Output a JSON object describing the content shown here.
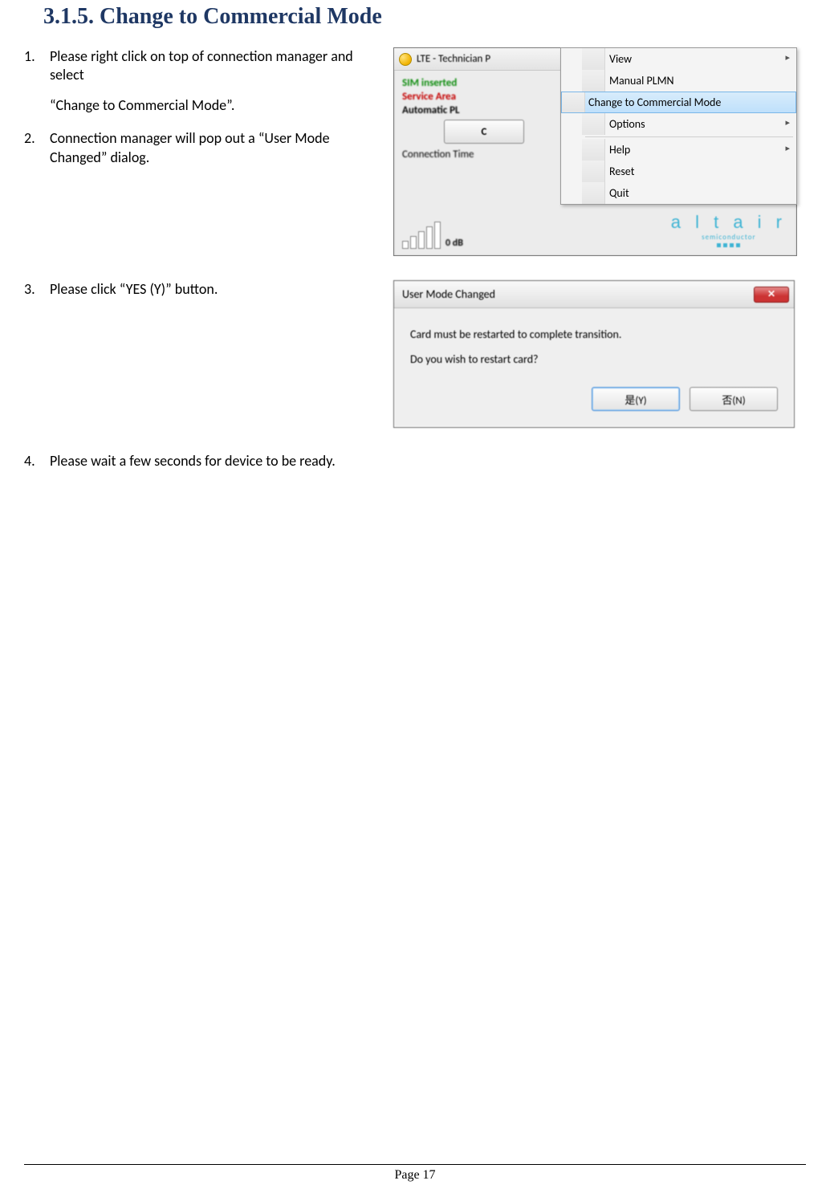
{
  "heading": {
    "number": "3.1.5.",
    "title": "Change to Commercial Mode"
  },
  "steps": [
    {
      "num": "1.",
      "text1": "Please right click on top of connection manager and select",
      "text2": "“Change to Commercial Mode”."
    },
    {
      "num": "2.",
      "text1": "Connection manager will pop out a “User Mode Changed” dialog."
    },
    {
      "num": "3.",
      "text1": "Please click “YES (Y)” button."
    },
    {
      "num": "4.",
      "text1": "Please wait a few seconds for device to be ready."
    }
  ],
  "conn_window": {
    "title": "LTE - Technician P",
    "sim": "SIM inserted",
    "svc": "Service Area",
    "auto": "Automatic PL",
    "big_btn": "C",
    "conn_time": "Connection Time",
    "signal": "0 dB",
    "logo_main": "a l t a i r",
    "logo_sub": "semiconductor"
  },
  "context_menu": {
    "items": [
      {
        "label": "View",
        "sub": true
      },
      {
        "label": "Manual PLMN"
      },
      {
        "label": "Change to Commercial Mode",
        "selected": true
      },
      {
        "label": "Options",
        "sub": true
      },
      {
        "label": "Help",
        "sub": true,
        "sep_before": true
      },
      {
        "label": "Reset"
      },
      {
        "label": "Quit"
      }
    ]
  },
  "dialog": {
    "title": "User Mode Changed",
    "line1": "Card must be restarted to complete transition.",
    "line2": "Do you wish to restart card?",
    "yes": "是(Y)",
    "no": "否(N)"
  },
  "footer": "Page 17"
}
